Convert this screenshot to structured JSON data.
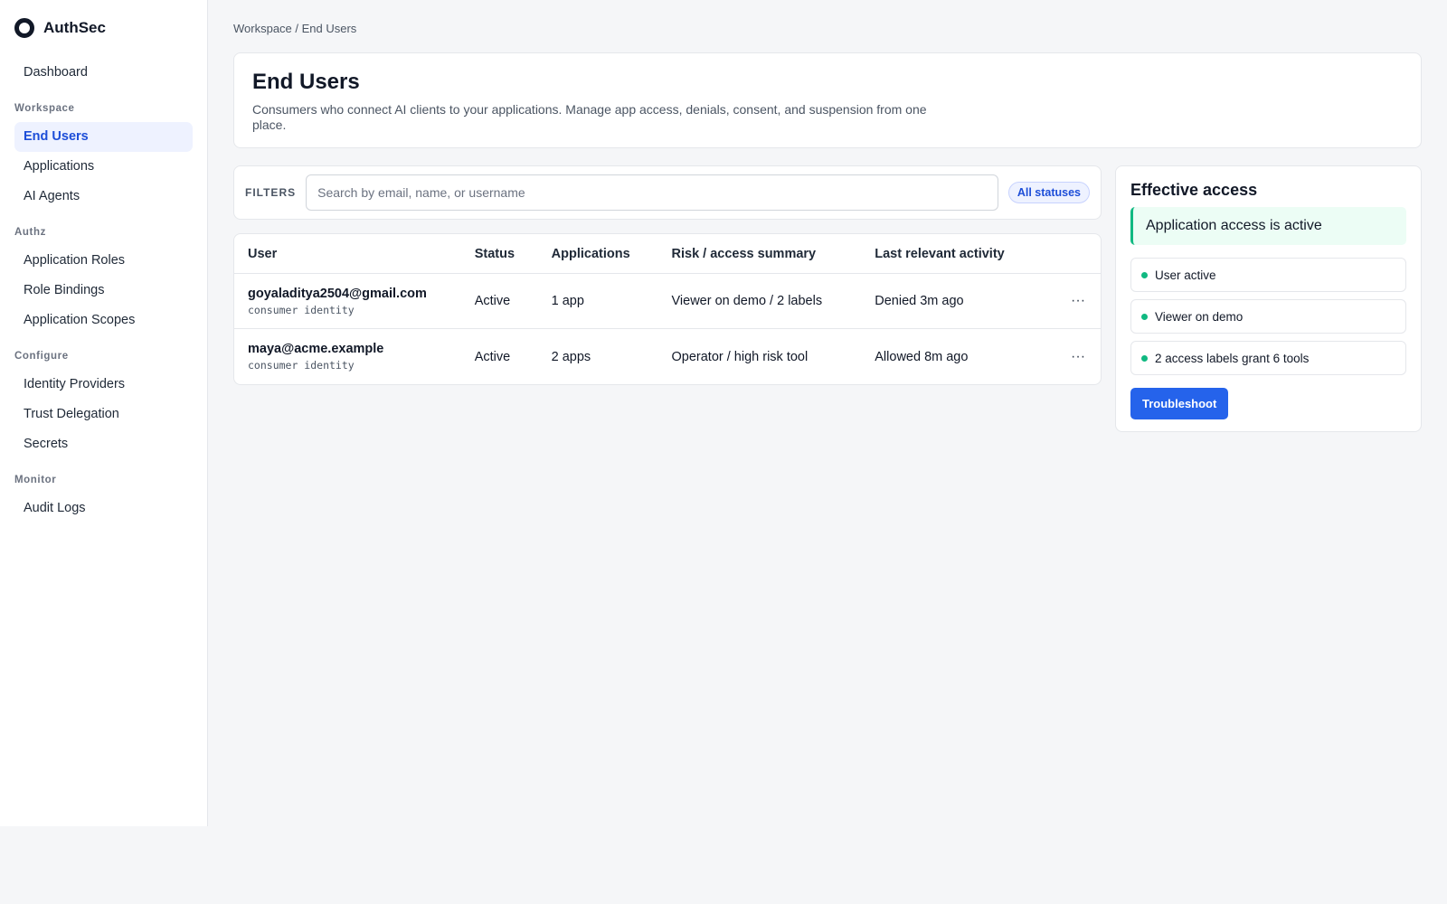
{
  "app": {
    "name": "AuthSec"
  },
  "sidebar": {
    "top_items": [
      {
        "label": "Dashboard"
      }
    ],
    "sections": [
      {
        "title": "Workspace",
        "items": [
          {
            "label": "End Users"
          },
          {
            "label": "Applications"
          },
          {
            "label": "AI Agents"
          }
        ]
      },
      {
        "title": "Authz",
        "items": [
          {
            "label": "Application Roles"
          },
          {
            "label": "Role Bindings"
          },
          {
            "label": "Application Scopes"
          }
        ]
      },
      {
        "title": "Configure",
        "items": [
          {
            "label": "Identity Providers"
          },
          {
            "label": "Trust Delegation"
          },
          {
            "label": "Secrets"
          }
        ]
      },
      {
        "title": "Monitor",
        "items": [
          {
            "label": "Audit Logs"
          }
        ]
      }
    ],
    "active_item": "End Users"
  },
  "breadcrumb": "Workspace / End Users",
  "header": {
    "title": "End Users",
    "description": "Consumers who connect AI clients to your applications. Manage app access, denials, consent, and suspension from one place."
  },
  "filters": {
    "label": "FILTERS",
    "search_placeholder": "Search by email, name, or username",
    "status_pill": "All statuses"
  },
  "table": {
    "columns": [
      "User",
      "Status",
      "Applications",
      "Risk / access summary",
      "Last relevant activity"
    ],
    "rows": [
      {
        "email": "goyaladitya2504@gmail.com",
        "type": "consumer identity",
        "status": "Active",
        "apps": "1 app",
        "risk": "Viewer on demo / 2 labels",
        "activity": "Denied 3m ago",
        "actions": "···"
      },
      {
        "email": "maya@acme.example",
        "type": "consumer identity",
        "status": "Active",
        "apps": "2 apps",
        "risk": "Operator / high risk tool",
        "activity": "Allowed 8m ago",
        "actions": "···"
      }
    ]
  },
  "access_panel": {
    "title": "Effective access",
    "banner": "Application access is active",
    "items": [
      {
        "label": "User active"
      },
      {
        "label": "Viewer on demo"
      },
      {
        "label": "2 access labels grant 6 tools"
      }
    ],
    "button": "Troubleshoot"
  },
  "colors": {
    "accent": "#2563eb",
    "success": "#10b981",
    "active_nav_bg": "#eef2ff"
  }
}
